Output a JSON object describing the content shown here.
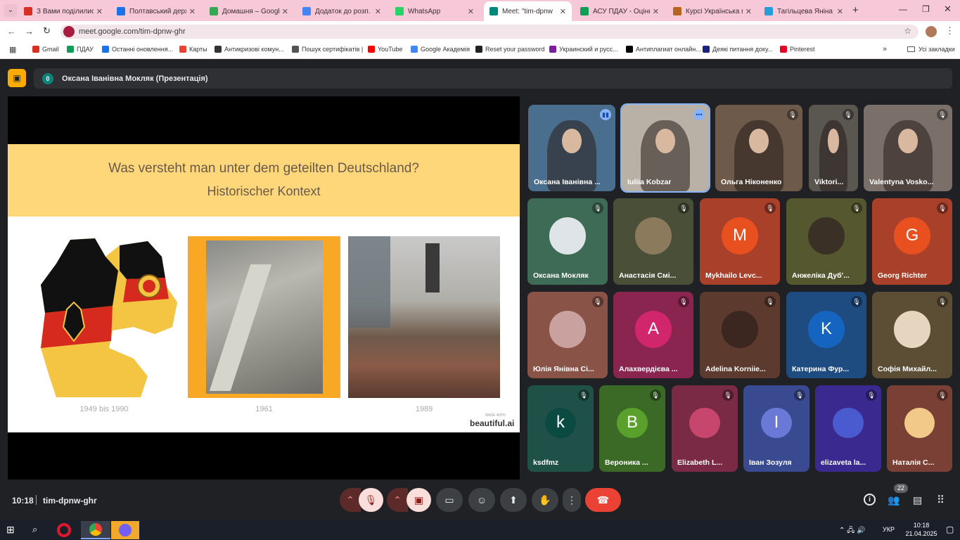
{
  "browser": {
    "tabs": [
      {
        "label": "З Вами поділилися д",
        "icon": "gmail-icon",
        "color": "#d93025"
      },
      {
        "label": "Полтавський держав",
        "icon": "page-icon",
        "color": "#1a73e8"
      },
      {
        "label": "Домашня – Google Д",
        "icon": "drive-icon",
        "color": "#34a853"
      },
      {
        "label": "Додаток до розп. №",
        "icon": "docs-icon",
        "color": "#4285f4"
      },
      {
        "label": "WhatsApp",
        "icon": "whatsapp-icon",
        "color": "#25d366"
      },
      {
        "label": "Meet: \"tim-dpnw",
        "icon": "meet-icon",
        "color": "#00897b"
      },
      {
        "label": "АСУ ПДАУ - Оцінки",
        "icon": "sheet-icon",
        "color": "#0f9d58"
      },
      {
        "label": "Курсі Українська мо",
        "icon": "course-icon",
        "color": "#b5651d"
      },
      {
        "label": "Тагільцева Яніна Ми",
        "icon": "telegram-icon",
        "color": "#229ed9"
      }
    ],
    "url": "meet.google.com/tim-dpnw-ghr",
    "bookmarks": [
      {
        "label": "Gmail",
        "color": "#d93025"
      },
      {
        "label": "ПДАУ",
        "color": "#0f9d58"
      },
      {
        "label": "Останні оновлення...",
        "color": "#1a73e8"
      },
      {
        "label": "Карты",
        "color": "#ea4335"
      },
      {
        "label": "Антикризові комун...",
        "color": "#333333"
      },
      {
        "label": "Пошук сертифікатів |",
        "color": "#555555"
      },
      {
        "label": "YouTube",
        "color": "#ff0000"
      },
      {
        "label": "Google Академія",
        "color": "#4285f4"
      },
      {
        "label": "Reset your password",
        "color": "#222222"
      },
      {
        "label": "Украинский и русс...",
        "color": "#7b1fa2"
      },
      {
        "label": "Антиплагиат онлайн...",
        "color": "#000000"
      },
      {
        "label": "Деякі питання доку...",
        "color": "#1a237e"
      },
      {
        "label": "Pinterest",
        "color": "#e60023"
      }
    ],
    "all_bookmarks": "Усі закладки"
  },
  "meet": {
    "presenter_badge": "0",
    "presenter_label": "Оксана Іванівна Мокляк (Презентація)",
    "time": "10:18",
    "meeting_code": "tim-dpnw-ghr",
    "participants_count": "22",
    "accent": "#f9ab00",
    "hangup_color": "#ea4335"
  },
  "slide": {
    "title": "Was versteht man unter dem geteilten Deutschland?",
    "subtitle": "Historischer Kontext",
    "captions": [
      "1949 bis 1990",
      "1961",
      "1989"
    ],
    "made_with": "MADE WITH",
    "brand": "beautiful.ai"
  },
  "participants": [
    {
      "name": "Оксана Іванівна ...",
      "bg": "#4a6f8e",
      "kind": "video",
      "icon": "audio-icon"
    },
    {
      "name": "Iuliia Kobzar",
      "bg": "#b9b0a6",
      "kind": "video",
      "icon": "more-icon"
    },
    {
      "name": "Ольга Ніконенко",
      "bg": "#6e5a4a",
      "kind": "video",
      "icon": "mic-off-icon"
    },
    {
      "name": "Viktori...",
      "bg": "#5a5650",
      "kind": "video",
      "icon": "mic-off-icon"
    },
    {
      "name": "Valentyna Vosko...",
      "bg": "#7b6f6a",
      "kind": "video",
      "icon": "mic-off-icon"
    },
    {
      "name": "Оксана Мокляк",
      "bg": "#3e6b55",
      "kind": "photo",
      "avbg": "#dfe4e8",
      "icon": "mic-off-icon"
    },
    {
      "name": "Анастасія Смі...",
      "bg": "#4a4f38",
      "kind": "photo",
      "avbg": "#8c7a5c",
      "icon": "mic-off-icon"
    },
    {
      "name": "Mykhailo Levc...",
      "bg": "#a8402a",
      "kind": "letter",
      "letter": "M",
      "avbg": "#e8501f",
      "icon": "mic-off-icon"
    },
    {
      "name": "Анжеліка Дуб'...",
      "bg": "#55572f",
      "kind": "photo",
      "avbg": "#3a3026",
      "icon": "mic-off-icon"
    },
    {
      "name": "Georg Richter",
      "bg": "#a8402a",
      "kind": "letter",
      "letter": "G",
      "avbg": "#e8501f",
      "icon": "mic-off-icon"
    },
    {
      "name": "Юлія Янівна Сі...",
      "bg": "#8a5348",
      "kind": "photo",
      "avbg": "#c9a2a0",
      "icon": "mic-off-icon"
    },
    {
      "name": "Алахвердієва ...",
      "bg": "#8a2550",
      "kind": "letter",
      "letter": "A",
      "avbg": "#d1266b",
      "icon": "mic-off-icon"
    },
    {
      "name": "Adelina Korniie...",
      "bg": "#5c3a2e",
      "kind": "photo",
      "avbg": "#3b2720",
      "icon": "mic-off-icon"
    },
    {
      "name": "Катерина Фур...",
      "bg": "#1e4c80",
      "kind": "letter",
      "letter": "K",
      "avbg": "#1565c0",
      "icon": "mic-off-icon"
    },
    {
      "name": "Софія Михайл...",
      "bg": "#5c4e35",
      "kind": "photo",
      "avbg": "#e6d5bf",
      "icon": "mic-off-icon"
    },
    {
      "name": "ksdfmz",
      "bg": "#1f5148",
      "kind": "letter",
      "letter": "k",
      "avbg": "#0b4a40",
      "icon": "mic-off-icon"
    },
    {
      "name": "Вероника ...",
      "bg": "#3a6a25",
      "kind": "letter",
      "letter": "B",
      "avbg": "#5aa02c",
      "icon": "mic-off-icon"
    },
    {
      "name": "Elizabeth L...",
      "bg": "#7a2a45",
      "kind": "photo",
      "avbg": "#c7466e",
      "icon": "mic-off-icon"
    },
    {
      "name": "Іван Зозуля",
      "bg": "#3a4a90",
      "kind": "letter",
      "letter": "I",
      "avbg": "#6a78d6",
      "icon": "mic-off-icon"
    },
    {
      "name": "elizaveta la...",
      "bg": "#3a2a90",
      "kind": "photo",
      "avbg": "#4a5bd0",
      "icon": "mic-off-icon"
    },
    {
      "name": "Наталія С...",
      "bg": "#7a4035",
      "kind": "photo",
      "avbg": "#f3c98a",
      "icon": "mic-off-icon"
    }
  ],
  "taskbar": {
    "lang": "УКР",
    "time": "10:18",
    "date": "21.04.2025"
  }
}
